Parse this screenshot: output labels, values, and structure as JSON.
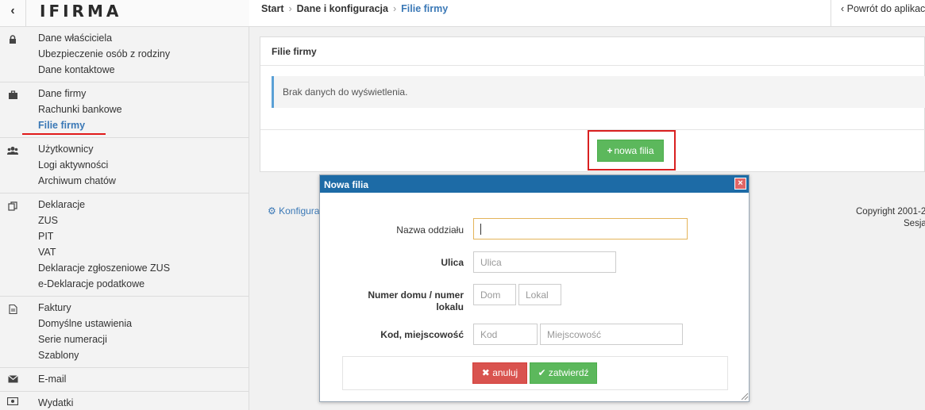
{
  "sidebar": {
    "back_icon": "chevron-left-icon",
    "logo": "IFIRMA",
    "groups": [
      {
        "icon": "lock-icon",
        "items": [
          "Dane właściciela",
          "Ubezpieczenie osób z rodziny",
          "Dane kontaktowe"
        ]
      },
      {
        "icon": "briefcase-icon",
        "items": [
          "Dane firmy",
          "Rachunki bankowe",
          "Filie firmy"
        ]
      },
      {
        "icon": "users-icon",
        "items": [
          "Użytkownicy",
          "Logi aktywności",
          "Archiwum chatów"
        ]
      },
      {
        "icon": "copy-icon",
        "items": [
          "Deklaracje",
          "ZUS",
          "PIT",
          "VAT",
          "Deklaracje zgłoszeniowe ZUS",
          "e-Deklaracje podatkowe"
        ]
      },
      {
        "icon": "document-icon",
        "items": [
          "Faktury",
          "Domyślne ustawienia",
          "Serie numeracji",
          "Szablony"
        ]
      },
      {
        "icon": "envelope-icon",
        "items": [
          "E-mail"
        ]
      },
      {
        "icon": "money-icon",
        "items": [
          "Wydatki"
        ]
      }
    ],
    "active_item": "Filie firmy"
  },
  "breadcrumb": {
    "items": [
      "Start",
      "Dane i konfiguracja",
      "Filie firmy"
    ]
  },
  "back_link": "Powrót do aplikacji",
  "panel": {
    "title": "Filie firmy",
    "empty_message": "Brak danych do wyświetlenia.",
    "new_button": "nowa filia"
  },
  "footer": {
    "config_link": "Konfiguracja",
    "copyright_line1": "Copyright 2001-2",
    "copyright_line2": "Sesja"
  },
  "modal": {
    "title": "Nowa filia",
    "close_label": "×",
    "fields": {
      "branch_name_label": "Nazwa oddziału",
      "branch_name_value": "",
      "street_label": "Ulica",
      "street_placeholder": "Ulica",
      "house_label_line1": "Numer domu / numer",
      "house_label_line2": "lokalu",
      "house_placeholder": "Dom",
      "flat_placeholder": "Lokal",
      "zip_city_label": "Kod, miejscowość",
      "zip_placeholder": "Kod",
      "city_placeholder": "Miejscowość"
    },
    "cancel_button": "anuluj",
    "confirm_button": "zatwierdź"
  },
  "colors": {
    "accent": "#1d6ba6",
    "link": "#3a78b6",
    "success": "#5cb85c",
    "danger": "#d9534f",
    "highlight": "#d92020"
  }
}
